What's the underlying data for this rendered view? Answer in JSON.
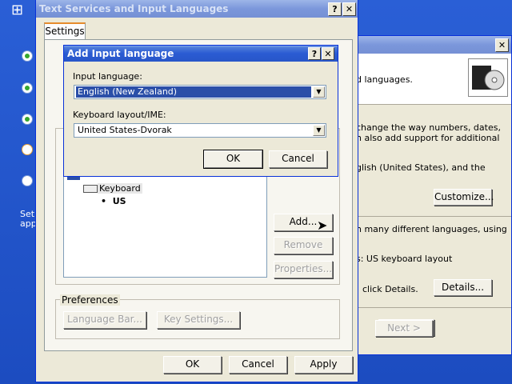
{
  "desktop": {
    "setup_text_line1": "Set",
    "setup_text_line2": "app",
    "start_glyph": "⊞"
  },
  "wizard": {
    "paragraph1": "d languages.",
    "paragraph2_line1": "change the way numbers, dates,",
    "paragraph2_line2": "n also add support for additional",
    "paragraph3": "glish (United States), and the",
    "customize_label": "Customize...",
    "paragraph4": "n many different languages, using",
    "paragraph5": "s: US keyboard layout",
    "paragraph6": "click Details.",
    "details_label": "Details...",
    "next_label": "Next >"
  },
  "text_services": {
    "title": "Text Services and Input Languages",
    "tab_settings": "Settings",
    "tree_keyboard": "Keyboard",
    "tree_us": "US",
    "add_label": "Add...",
    "remove_label": "Remove",
    "properties_label": "Properties...",
    "preferences_label": "Preferences",
    "language_bar_label": "Language Bar...",
    "key_settings_label": "Key Settings...",
    "ok_label": "OK",
    "cancel_label": "Cancel",
    "apply_label": "Apply",
    "help_glyph": "?",
    "close_glyph": "✕"
  },
  "add_input": {
    "title": "Add Input language",
    "input_language_label": "Input language:",
    "input_language_value": "English (New Zealand)",
    "keyboard_layout_label": "Keyboard layout/IME:",
    "keyboard_layout_value": "United States-Dvorak",
    "ok_label": "OK",
    "cancel_label": "Cancel",
    "help_glyph": "?",
    "close_glyph": "✕",
    "dropdown_arrow": "▼"
  }
}
